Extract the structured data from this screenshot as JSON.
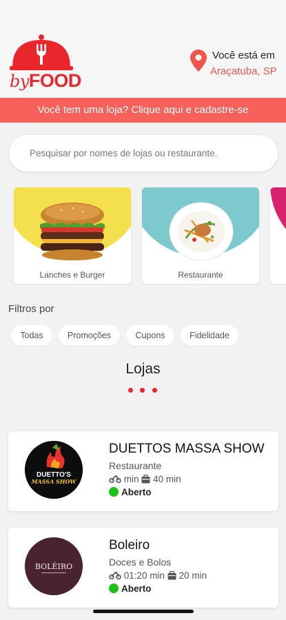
{
  "brand": {
    "name_by": "by",
    "name_food": "FOOD",
    "color": "#e8262b"
  },
  "location": {
    "label": "Você está em",
    "city": "Araçatuba, SP",
    "icon": "map-pin-icon"
  },
  "banner": {
    "text": "Você tem uma loja? Clique aqui e cadastre-se",
    "color": "#f7615a"
  },
  "search": {
    "placeholder": "Pesquisar por nomes de lojas ou restaurante.",
    "value": ""
  },
  "categories": [
    {
      "label": "Lanches e Burger",
      "accent": "#f4e04d",
      "icon": "burger-image"
    },
    {
      "label": "Restaurante",
      "accent": "#7ec9cd",
      "icon": "plate-image"
    },
    {
      "label": "",
      "accent": "#d8226e",
      "icon": "partial-category-image"
    }
  ],
  "filters": {
    "title": "Filtros por",
    "chips": [
      "Todas",
      "Promoções",
      "Cupons",
      "Fidelidade"
    ]
  },
  "stores_section": {
    "title": "Lojas"
  },
  "stores": [
    {
      "name": "DUETTOS MASSA SHOW",
      "category": "Restaurante",
      "delivery_time": "min",
      "pickup_time": "40 min",
      "status": "Aberto",
      "logo_text_1": "DUETTO'S",
      "logo_text_2": "MASSA SHOW"
    },
    {
      "name": "Boleiro",
      "category": "Doces e Bolos",
      "delivery_time": "01:20 min",
      "pickup_time": "20 min",
      "status": "Aberto",
      "logo_text_1": "BOLÉIRO"
    }
  ],
  "colors": {
    "status_open": "#1fc01a",
    "accent_text": "#f0564e"
  }
}
